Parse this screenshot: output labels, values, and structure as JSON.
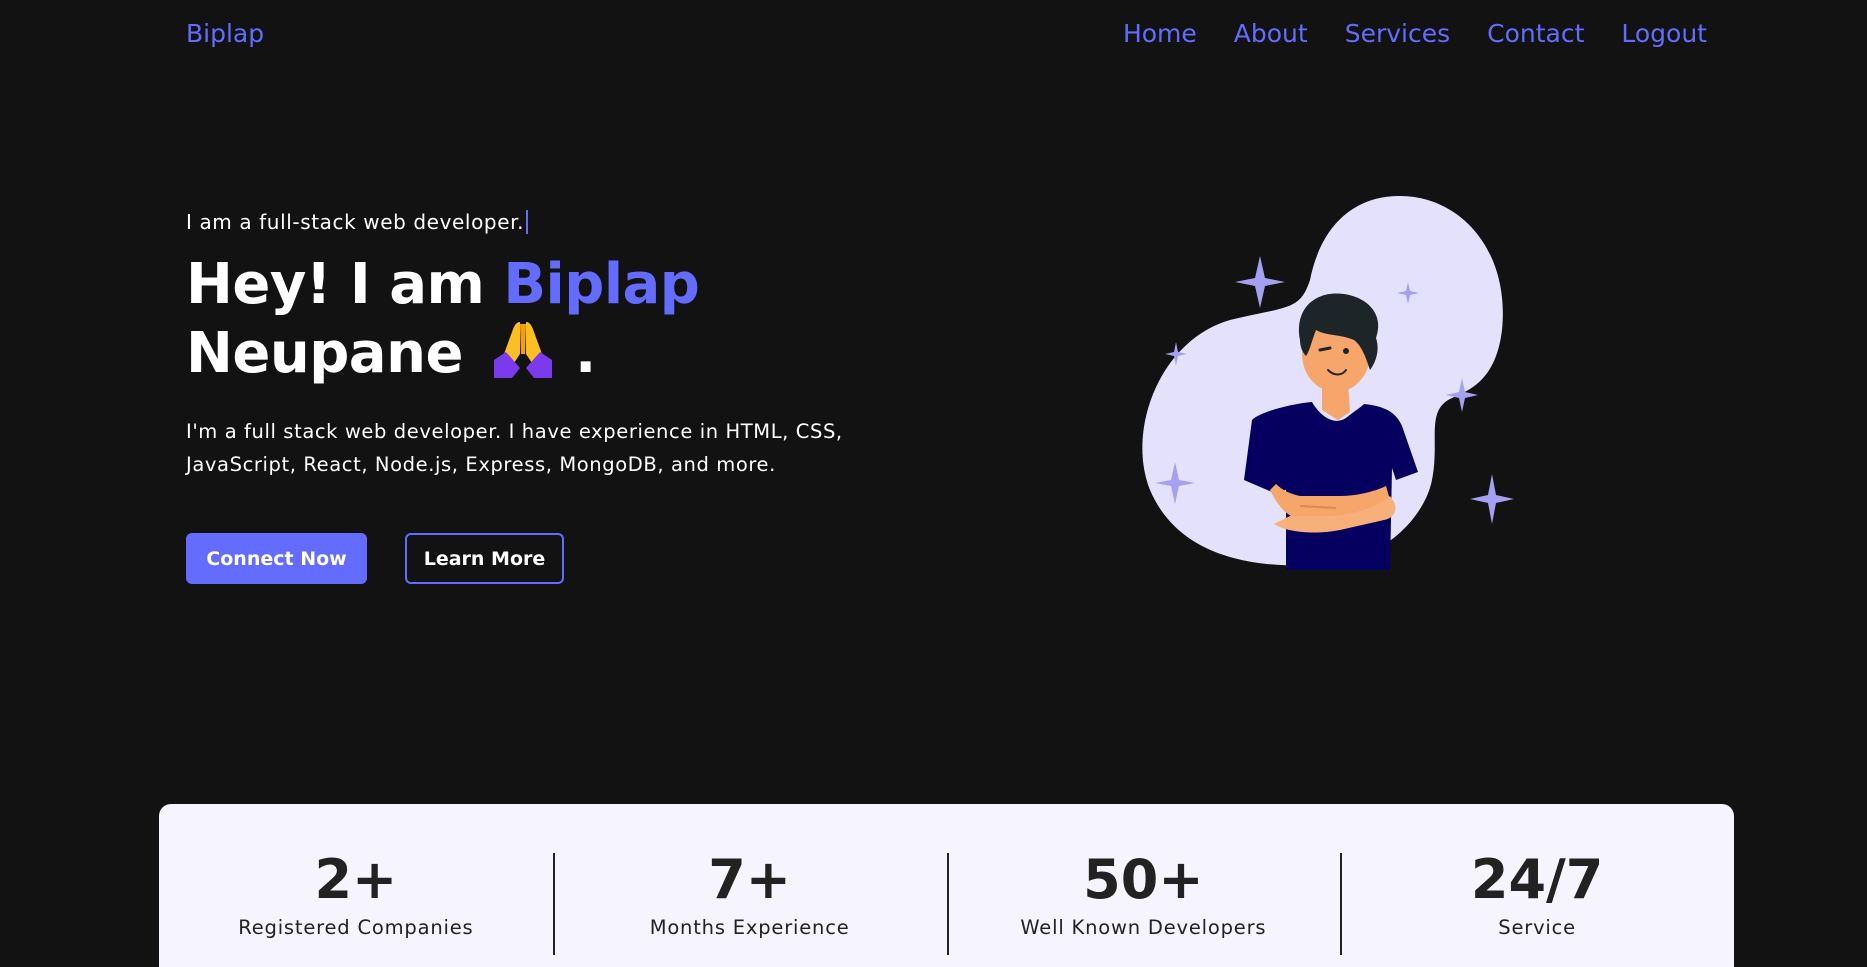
{
  "nav": {
    "brand": "Biplap",
    "links": [
      "Home",
      "About",
      "Services",
      "Contact",
      "Logout"
    ]
  },
  "hero": {
    "tagline": "I am a full-stack web developer.",
    "headline_prefix": "Hey! I am ",
    "headline_accent": "Biplap",
    "headline_line2": "Neupane",
    "headline_end": ".",
    "bio": "I'm a full stack web developer. I have experience in HTML, CSS, JavaScript, React, Node.js, Express, MongoDB, and more.",
    "primary_button": "Connect Now",
    "secondary_button": "Learn More",
    "emoji_icon": "folded-hands-icon",
    "illustration_icon": "developer-illustration"
  },
  "stats": [
    {
      "value": "2+",
      "label": "Registered Companies"
    },
    {
      "value": "7+",
      "label": "Months Experience"
    },
    {
      "value": "50+",
      "label": "Well Known Developers"
    },
    {
      "value": "24/7",
      "label": "Service"
    }
  ],
  "colors": {
    "accent": "#646cff",
    "background": "#121212",
    "stats_background": "#f5f4ff"
  }
}
